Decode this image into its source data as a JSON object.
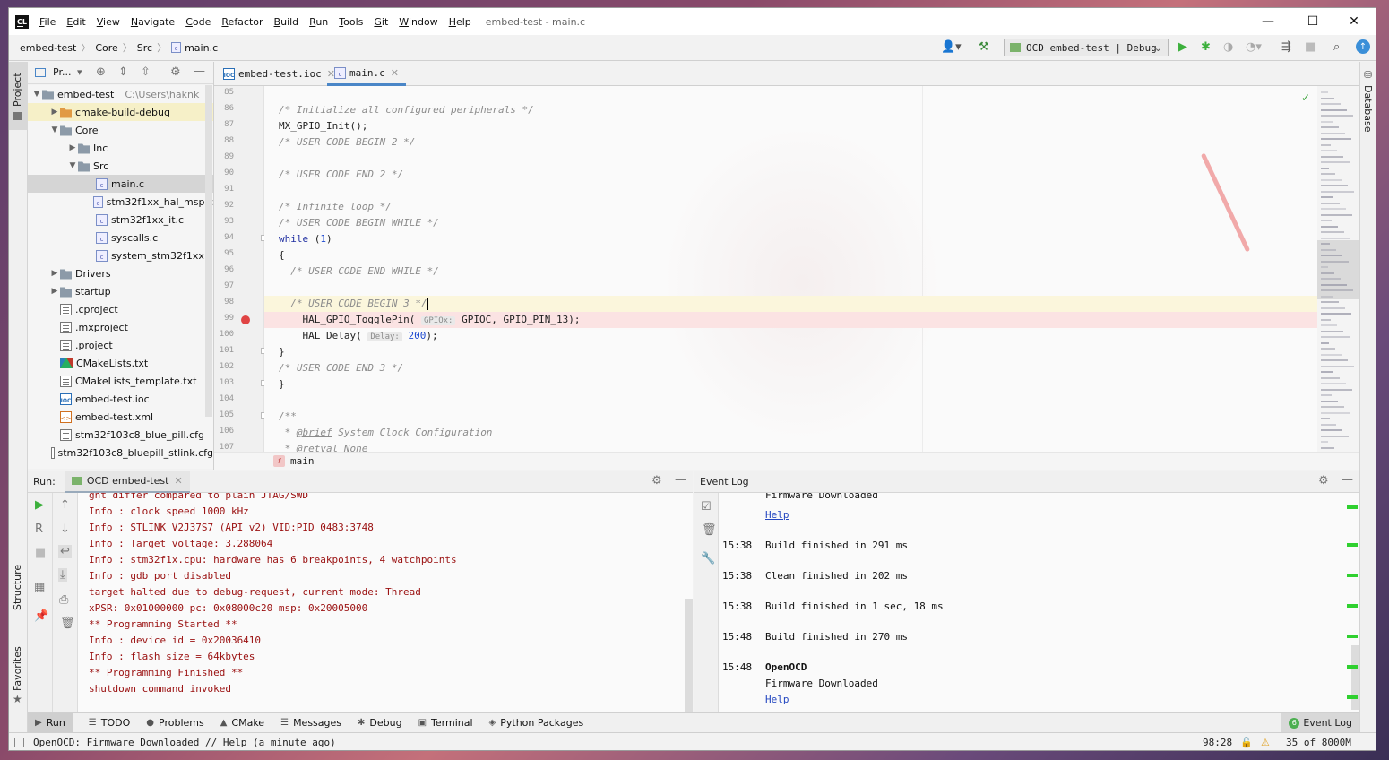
{
  "app_icon": "CL",
  "window": {
    "title": "embed-test - main.c",
    "minimize": "—",
    "maximize": "☐",
    "close": "✕"
  },
  "menu": [
    {
      "u": "F",
      "rest": "ile"
    },
    {
      "u": "E",
      "rest": "dit"
    },
    {
      "u": "V",
      "rest": "iew"
    },
    {
      "u": "N",
      "rest": "avigate"
    },
    {
      "u": "C",
      "rest": "ode"
    },
    {
      "u": "R",
      "rest": "efactor"
    },
    {
      "u": "B",
      "rest": "uild"
    },
    {
      "u": "R",
      "rest": "un"
    },
    {
      "u": "T",
      "rest": "ools"
    },
    {
      "u": "G",
      "rest": "it"
    },
    {
      "u": "W",
      "rest": "indow"
    },
    {
      "u": "H",
      "rest": "elp"
    }
  ],
  "breadcrumbs": [
    "embed-test",
    "Core",
    "Src",
    "main.c"
  ],
  "run_config": "OCD embed-test | Debug",
  "sidebar_left": {
    "project": "Project",
    "structure": "Structure",
    "favorites": "Favorites"
  },
  "sidebar_right": {
    "database": "Database"
  },
  "project_pane": {
    "title": "Pr...",
    "root_path": "C:\\Users\\haknk",
    "items": [
      {
        "label": "embed-test",
        "type": "folder",
        "level": 0,
        "expanded": true
      },
      {
        "label": "cmake-build-debug",
        "type": "folder-orange",
        "level": 1,
        "expanded": false
      },
      {
        "label": "Core",
        "type": "folder",
        "level": 1,
        "expanded": true
      },
      {
        "label": "Inc",
        "type": "folder",
        "level": 2,
        "expanded": false
      },
      {
        "label": "Src",
        "type": "folder",
        "level": 2,
        "expanded": true
      },
      {
        "label": "main.c",
        "type": "c",
        "level": 3,
        "selected": true
      },
      {
        "label": "stm32f1xx_hal_msp.c",
        "type": "c",
        "level": 3
      },
      {
        "label": "stm32f1xx_it.c",
        "type": "c",
        "level": 3
      },
      {
        "label": "syscalls.c",
        "type": "c",
        "level": 3
      },
      {
        "label": "system_stm32f1xx.c",
        "type": "c",
        "level": 3
      },
      {
        "label": "Drivers",
        "type": "folder",
        "level": 1,
        "expanded": false
      },
      {
        "label": "startup",
        "type": "folder",
        "level": 1,
        "expanded": false
      },
      {
        "label": ".cproject",
        "type": "txt",
        "level": 1
      },
      {
        "label": ".mxproject",
        "type": "txt",
        "level": 1
      },
      {
        "label": ".project",
        "type": "txt",
        "level": 1
      },
      {
        "label": "CMakeLists.txt",
        "type": "cmake",
        "level": 1
      },
      {
        "label": "CMakeLists_template.txt",
        "type": "txt",
        "level": 1
      },
      {
        "label": "embed-test.ioc",
        "type": "ioc",
        "level": 1
      },
      {
        "label": "embed-test.xml",
        "type": "xml",
        "level": 1
      },
      {
        "label": "stm32f103c8_blue_pill.cfg",
        "type": "txt",
        "level": 1
      },
      {
        "label": "stm32f103c8_bluepill_stlink.cfg",
        "type": "txt",
        "level": 1
      }
    ]
  },
  "editor": {
    "tabs": [
      {
        "label": "embed-test.ioc",
        "icon": "ioc",
        "active": false
      },
      {
        "label": "main.c",
        "icon": "c",
        "active": true
      }
    ],
    "lines": [
      {
        "n": "85",
        "html": ""
      },
      {
        "n": "86",
        "html": "<span class='cmt'>/* Initialize all configured peripherals */</span>"
      },
      {
        "n": "87",
        "html": "MX_GPIO_Init();"
      },
      {
        "n": "88",
        "html": "<span class='cmt'>/* USER CODE BEGIN 2 */</span>"
      },
      {
        "n": "89",
        "html": ""
      },
      {
        "n": "90",
        "html": "<span class='cmt'>/* USER CODE END 2 */</span>"
      },
      {
        "n": "91",
        "html": ""
      },
      {
        "n": "92",
        "html": "<span class='cmt'>/* Infinite loop */</span>"
      },
      {
        "n": "93",
        "html": "<span class='cmt'>/* USER CODE BEGIN WHILE */</span>"
      },
      {
        "n": "94",
        "html": "<span class='kw'>while</span> (<span class='num'>1</span>)"
      },
      {
        "n": "95",
        "html": "{"
      },
      {
        "n": "96",
        "html": "  <span class='cmt'>/* USER CODE END WHILE */</span>"
      },
      {
        "n": "97",
        "html": ""
      },
      {
        "n": "98",
        "html": "  <span class='cmt'>/* USER CODE BEGIN 3 */</span>"
      },
      {
        "n": "99",
        "html": "    HAL_GPIO_TogglePin( <span class='hint'>GPIOx:</span> GPIOC, GPIO_PIN_13);"
      },
      {
        "n": "100",
        "html": "    HAL_Delay( <span class='hint'>Delay:</span> <span class='num'>200</span>);"
      },
      {
        "n": "101",
        "html": "}"
      },
      {
        "n": "102",
        "html": "<span class='cmt'>/* USER CODE END 3 */</span>"
      },
      {
        "n": "103",
        "html": "}"
      },
      {
        "n": "104",
        "html": ""
      },
      {
        "n": "105",
        "html": "<span class='cmt'>/**</span>"
      },
      {
        "n": "106",
        "html": "<span class='cmt'> * <u>@brief</u> System Clock Configuration</span>"
      },
      {
        "n": "107",
        "html": "<span class='cmt'> * @retval None</span>"
      }
    ],
    "breakpoint_line": "99",
    "caret_line": "98",
    "function_breadcrumb": "main"
  },
  "run_panel": {
    "label": "Run:",
    "tab": "OCD embed-test",
    "lines": [
      "ght differ compared to plain JTAG/SWD",
      "Info : clock speed 1000 kHz",
      "Info : STLINK V2J37S7 (API v2) VID:PID 0483:3748",
      "Info : Target voltage: 3.288064",
      "Info : stm32f1x.cpu: hardware has 6 breakpoints, 4 watchpoints",
      "Info : gdb port disabled",
      "target halted due to debug-request, current mode: Thread",
      "xPSR: 0x01000000 pc: 0x08000c20 msp: 0x20005000",
      "** Programming Started **",
      "Info : device id = 0x20036410",
      "Info : flash size = 64kbytes",
      "** Programming Finished **",
      "shutdown command invoked"
    ]
  },
  "event_log": {
    "title": "Event Log",
    "top_partial": "Firmware Downloaded",
    "top_link": "Help",
    "entries": [
      {
        "time": "15:38",
        "msg": "Build finished in 291 ms"
      },
      {
        "time": "15:38",
        "msg": "Clean finished in 202 ms"
      },
      {
        "time": "15:38",
        "msg": "Build finished in 1 sec, 18 ms"
      },
      {
        "time": "15:48",
        "msg": "Build finished in 270 ms"
      },
      {
        "time": "15:48",
        "msg": "OpenOCD",
        "msg2": "Firmware Downloaded",
        "link": "Help"
      }
    ]
  },
  "tool_windows": [
    {
      "label": "Run",
      "icon": "▶"
    },
    {
      "label": "TODO",
      "icon": "☰"
    },
    {
      "label": "Problems",
      "icon": "●"
    },
    {
      "label": "CMake",
      "icon": "▲"
    },
    {
      "label": "Messages",
      "icon": "☰"
    },
    {
      "label": "Debug",
      "icon": "✱"
    },
    {
      "label": "Terminal",
      "icon": "▣"
    },
    {
      "label": "Python Packages",
      "icon": "◈"
    }
  ],
  "event_log_button": {
    "count": "6",
    "label": "Event Log"
  },
  "status": {
    "message": "OpenOCD: Firmware Downloaded // Help (a minute ago)",
    "position": "98:28",
    "memory": "35 of 8000M"
  },
  "colors": {
    "accent": "#4a86c7",
    "breakpoint": "#e04444",
    "console_text": "#9a1010",
    "link": "#2447c0",
    "green": "#2fd02f"
  }
}
